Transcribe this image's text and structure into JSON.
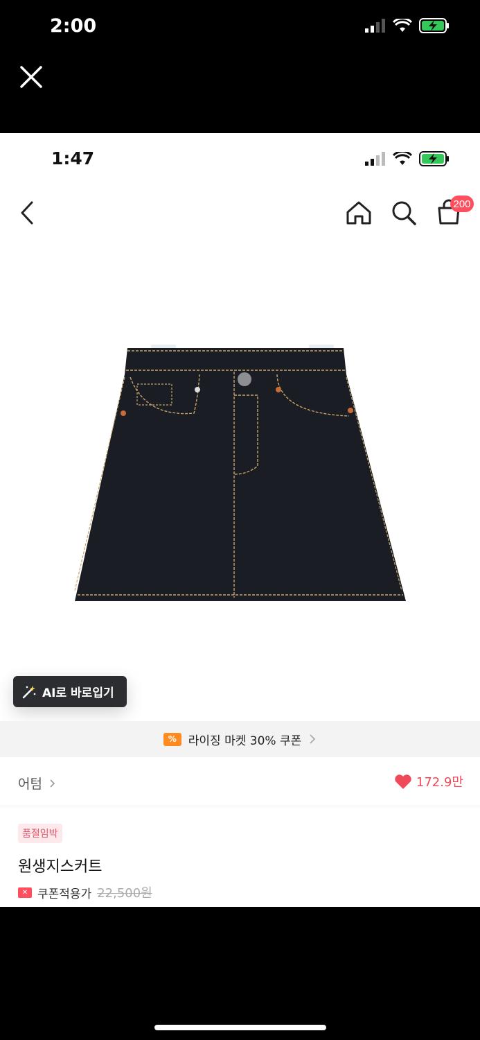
{
  "outer_status": {
    "time": "2:00"
  },
  "inner_status": {
    "time": "1:47"
  },
  "nav": {
    "cart_count": "200"
  },
  "product": {
    "image_alt": "denim mini skirt",
    "ai_try_on_label": "AI로 바로입기",
    "coupon_banner_text": "라이징 마켓 30% 쿠폰",
    "coupon_chip_icon": "%",
    "brand": "어텀",
    "likes": "172.9만",
    "soldout_tag": "품절임박",
    "title": "원생지스커트",
    "price_label": "쿠폰적용가",
    "original_price": "22,500원"
  },
  "colors": {
    "accent": "#ff4f5e",
    "heart": "#ef4a5a",
    "coupon_orange": "#ff8a1f"
  }
}
